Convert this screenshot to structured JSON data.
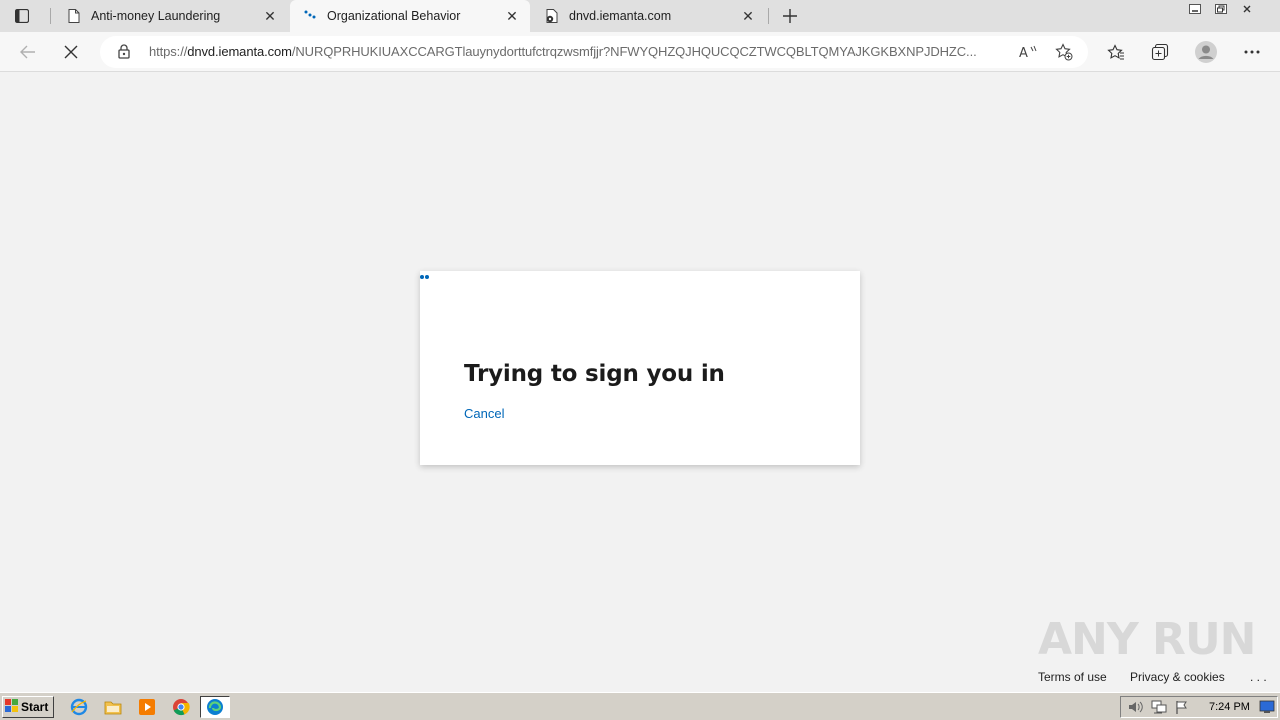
{
  "browser": {
    "tabs": [
      {
        "title": "Anti-money Laundering",
        "favicon": "document-icon",
        "active": false
      },
      {
        "title": "Organizational Behavior",
        "favicon": "loading-dots-icon",
        "active": true
      },
      {
        "title": "dnvd.iemanta.com",
        "favicon": "page-settings-icon",
        "active": false
      }
    ],
    "address": {
      "protocol": "https://",
      "host": "dnvd.iemanta.com",
      "path": "/NURQPRHUKIUAXCCARGTlauynydorttufctrqzwsmfjjr?NFWYQHZQJHQUCQCZTWCQBLTQMYAJKGKBXNPJDHZC..."
    },
    "toolbar_icons": [
      "back-icon",
      "stop-loading-icon",
      "lock-icon",
      "read-aloud-icon",
      "add-favorite-icon",
      "favorites-icon",
      "collections-icon",
      "profile-avatar",
      "more-icon"
    ]
  },
  "page": {
    "heading": "Trying to sign you in",
    "cancel": "Cancel",
    "footer": {
      "terms": "Terms of use",
      "privacy": "Privacy & cookies",
      "more": ". . ."
    },
    "watermark": "ANY RUN",
    "accent_color": "#0067b8"
  },
  "taskbar": {
    "start": "Start",
    "apps": [
      "internet-explorer-icon",
      "folder-icon",
      "media-player-icon",
      "chrome-icon",
      "edge-icon"
    ],
    "clock": "7:24 PM"
  }
}
